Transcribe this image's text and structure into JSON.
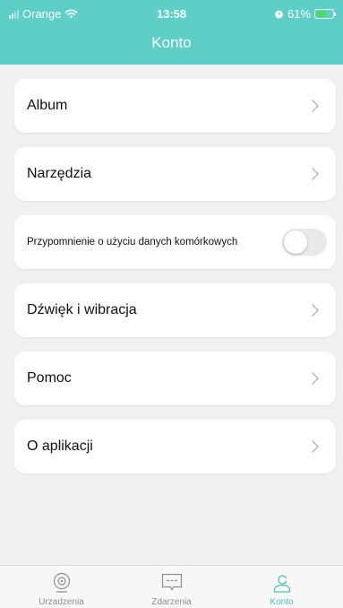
{
  "status_bar": {
    "carrier": "Orange",
    "time": "13:58",
    "battery": "61%",
    "battery_level": 0.61
  },
  "header": {
    "title": "Konto"
  },
  "menu": {
    "album": "Album",
    "tools": "Narzędzia",
    "data_reminder": "Przypomnienie o użyciu danych komórkowych",
    "data_reminder_enabled": false,
    "sound": "Dźwięk i wibracja",
    "help": "Pomoc",
    "about": "O aplikacji"
  },
  "tabs": [
    {
      "label": "Urzadzenia",
      "icon": "camera-icon",
      "active": false
    },
    {
      "label": "Zdarzenia",
      "icon": "message-icon",
      "active": false
    },
    {
      "label": "Konto",
      "icon": "person-icon",
      "active": true
    }
  ],
  "colors": {
    "header": "#5ecfc7",
    "active_tab": "#4cc3bb",
    "battery_fill": "#4cd964"
  }
}
